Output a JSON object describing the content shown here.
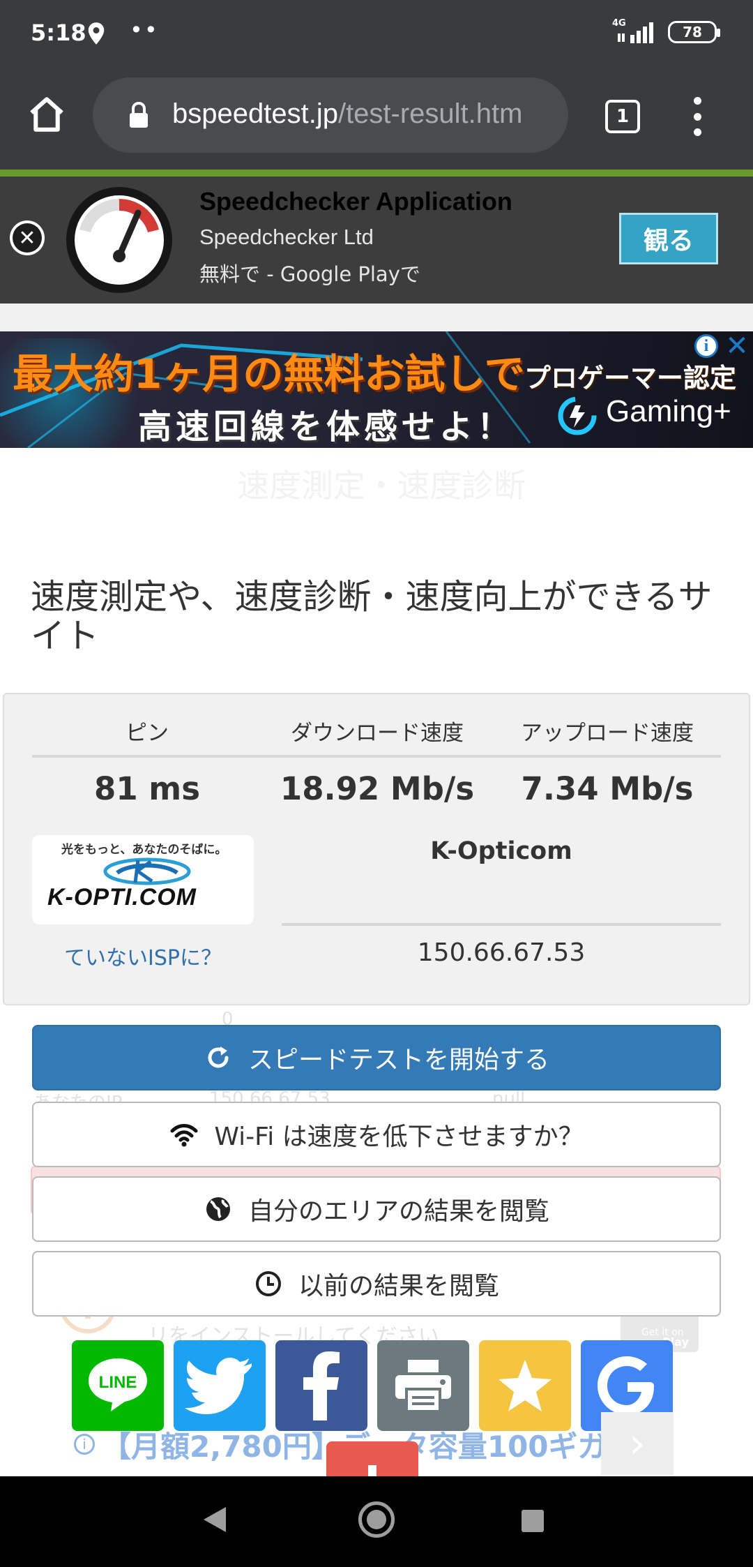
{
  "status_bar": {
    "time": "5:18",
    "dots": "••",
    "network": "4G",
    "battery": "78"
  },
  "browser": {
    "url_domain": "bspeedtest.jp",
    "url_path": "/test-result.htm",
    "tab_count": "1"
  },
  "app_ad": {
    "title": "Speedchecker Application",
    "developer": "Speedchecker Ltd",
    "subtitle": "無料で - Google Playで",
    "cta_label": "観る",
    "close_label": "✕"
  },
  "game_ad": {
    "line1": "最大約1ヶ月の無料お試しで",
    "line2": "高速回線を体感せよ！",
    "tagline": "プロゲーマー認定",
    "brand": "Gaming+",
    "info_label": "i",
    "close_label": "✕"
  },
  "page": {
    "ghost_heading": "速度測定・速度診断",
    "title": "速度測定や、速度診断・速度向上ができるサイト"
  },
  "results": {
    "headers": [
      "ピン",
      "ダウンロード速度",
      "アップロード速度"
    ],
    "values": [
      "81 ms",
      "18.92 Mb/s",
      "7.34 Mb/s"
    ],
    "isp_logo_slogan": "光をもっと、あなたのそばに。",
    "isp_logo_word": "K-OPTI.COM",
    "isp_name": "K-Opticom",
    "isp_question": "ていないISPに？",
    "ip_address": "150.66.67.53"
  },
  "background_faded": {
    "zero": "0",
    "ip_label": "あなたのIP",
    "ip_value": "150.66.67.53",
    "null_value": "null",
    "install_hint": "リをインストールしてください",
    "get_it_on": "Get it on",
    "play": "Play"
  },
  "buttons": {
    "start_test": "スピードテストを開始する",
    "wifi": "Wi-Fi は速度を低下させますか？",
    "area_results": "自分のエリアの結果を閲覧",
    "previous_results": "以前の結果を閲覧"
  },
  "share": {
    "line_label": "LINE",
    "colors": {
      "line": "#00b900",
      "twitter": "#1da1f2",
      "facebook": "#3b5998",
      "print": "#6c7a80",
      "favorite": "#f5c542",
      "google": "#4285f4"
    }
  },
  "bottom_ad": {
    "text": "【月額2,780円】データ容量100ギガ",
    "info_label": "i",
    "arrow": "›"
  },
  "colors": {
    "primary_button": "#337ab7",
    "chrome_bar": "#3a3b3d",
    "link": "#2f6fae"
  }
}
